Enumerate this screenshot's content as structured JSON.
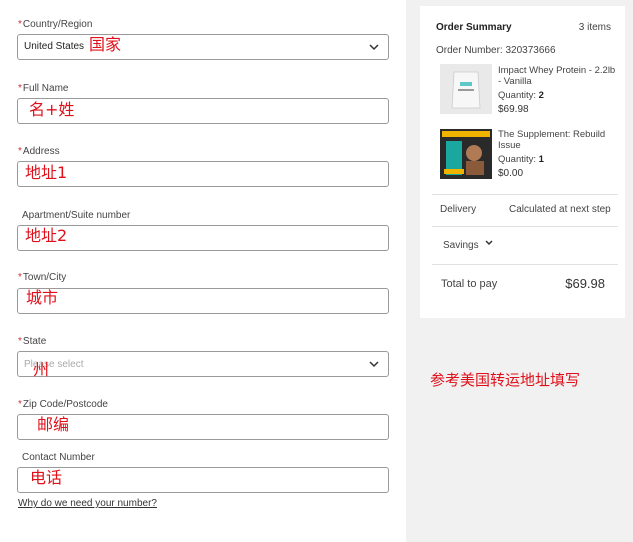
{
  "form": {
    "country": {
      "label": "Country/Region",
      "value": "United States",
      "annotation": "国家"
    },
    "full_name": {
      "label": "Full Name",
      "annotation": "名+姓"
    },
    "address": {
      "label": "Address",
      "annotation": "地址1"
    },
    "apartment": {
      "label": "Apartment/Suite number",
      "annotation": "地址2"
    },
    "town": {
      "label": "Town/City",
      "annotation": "城市"
    },
    "state": {
      "label": "State",
      "placeholder": "Please select",
      "annotation": "州"
    },
    "zip": {
      "label": "Zip Code/Postcode",
      "annotation": "邮编"
    },
    "contact": {
      "label": "Contact Number",
      "annotation": "电话"
    },
    "why_link": "Why do we need your number?",
    "required_mark": "*"
  },
  "note": "参考美国转运地址填写",
  "summary": {
    "title": "Order Summary",
    "count": "3 items",
    "order_number_label": "Order Number:",
    "order_number": "320373666",
    "products": [
      {
        "name": "Impact Whey Protein - 2.2lb - Vanilla",
        "quantity_label": "Quantity:",
        "quantity": "2",
        "price": "$69.98",
        "icon": "protein-bag-icon"
      },
      {
        "name": "The Supplement: Rebuild Issue",
        "quantity_label": "Quantity:",
        "quantity": "1",
        "price": "$0.00",
        "icon": "magazine-icon"
      }
    ],
    "delivery_label": "Delivery",
    "delivery_value": "Calculated at next step",
    "savings_label": "Savings",
    "total_label": "Total to pay",
    "total_value": "$69.98"
  }
}
